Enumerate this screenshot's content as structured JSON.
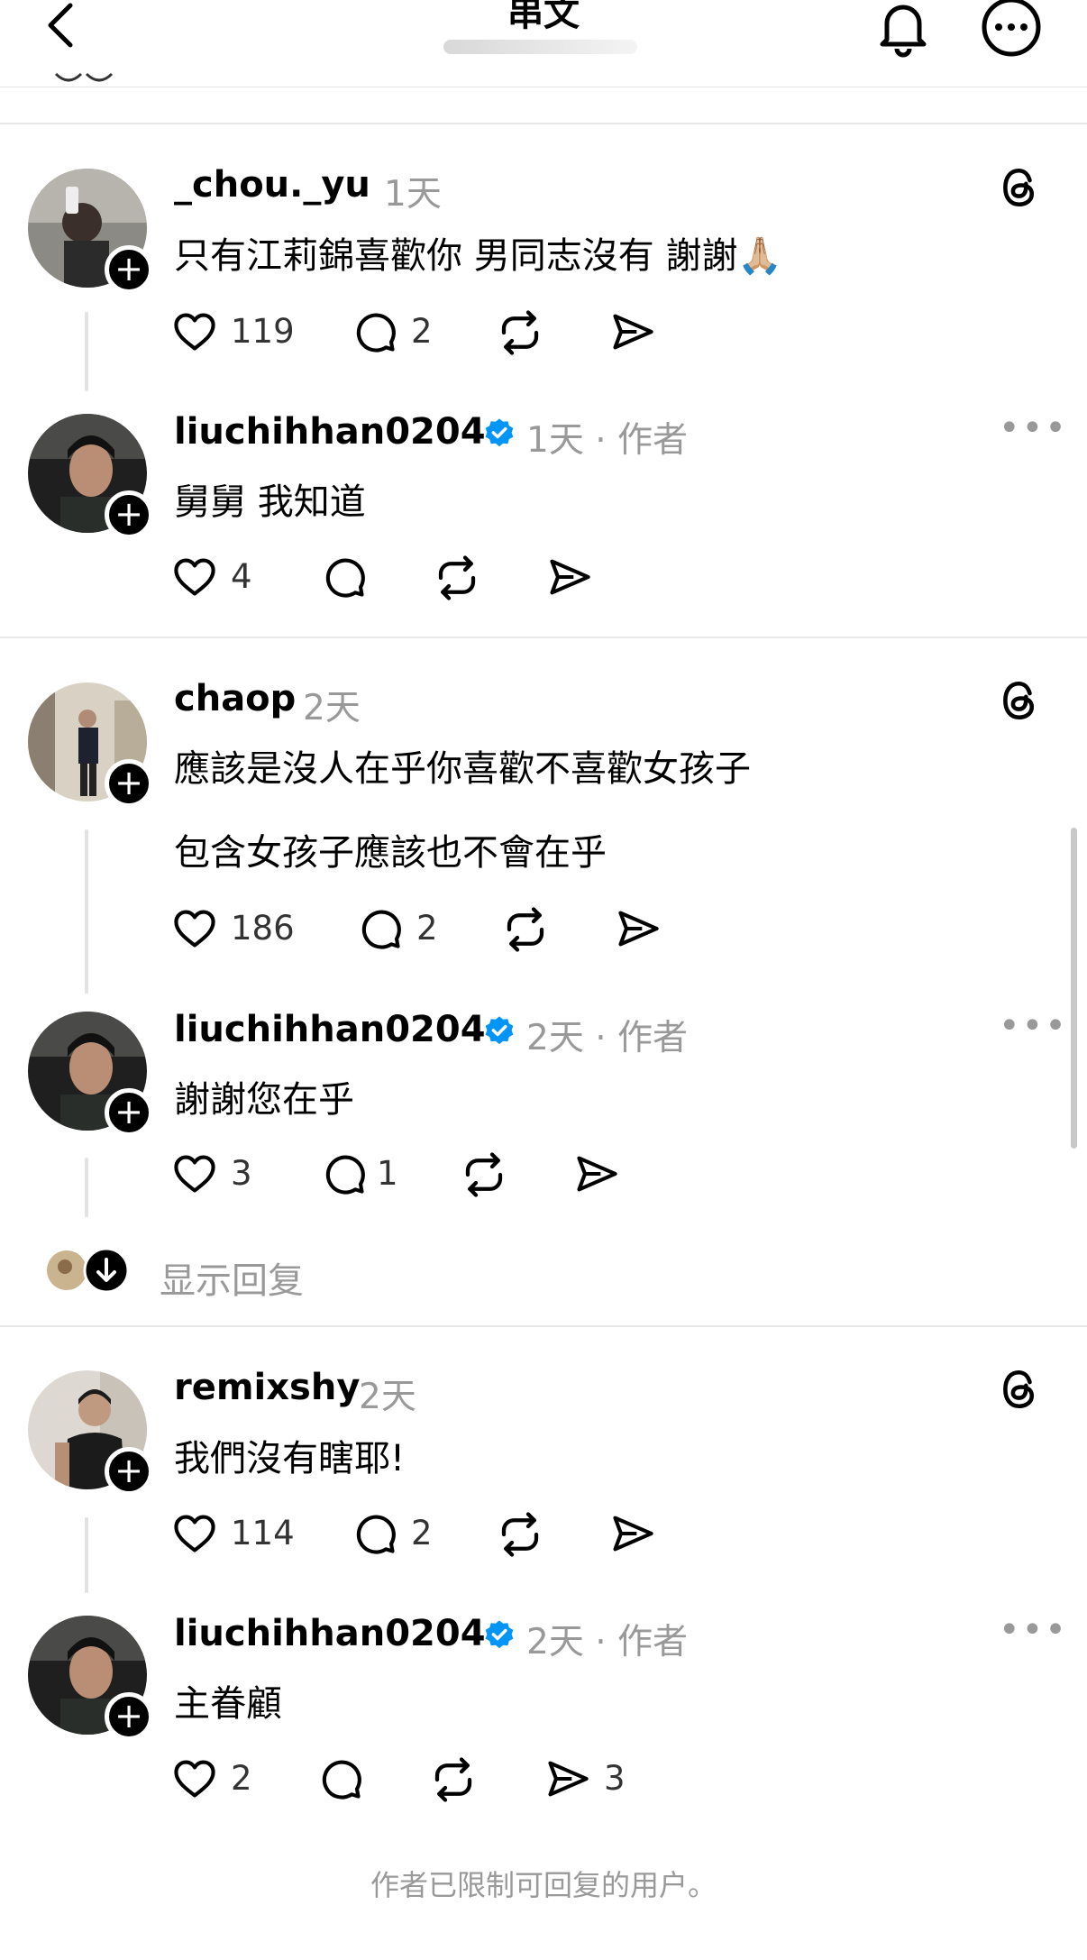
{
  "header": {
    "title": "串文"
  },
  "threads": [
    {
      "comment": {
        "username": "_chou._yu",
        "time": "1天",
        "text": "只有江莉錦喜歡你 男同志沒有 謝謝🙏🏼",
        "likes": "119",
        "replies": "2"
      },
      "reply": {
        "username": "liuchihhan0204",
        "meta": "1天 · 作者",
        "text": "舅舅 我知道",
        "likes": "4"
      }
    },
    {
      "comment": {
        "username": "chaop",
        "time": "2天",
        "text": "應該是沒人在乎你喜歡不喜歡女孩子",
        "text2": "包含女孩子應該也不會在乎",
        "likes": "186",
        "replies": "2"
      },
      "reply": {
        "username": "liuchihhan0204",
        "meta": "2天 · 作者",
        "text": "謝謝您在乎",
        "likes": "3",
        "replies": "1"
      },
      "show_replies": "显示回复"
    },
    {
      "comment": {
        "username": "remixshy",
        "time": "2天",
        "text": "我們沒有瞎耶!",
        "likes": "114",
        "replies": "2"
      },
      "reply": {
        "username": "liuchihhan0204",
        "meta": "2天 · 作者",
        "text": "主眷顧",
        "likes": "2",
        "shares": "3"
      }
    }
  ],
  "footer": "作者已限制可回复的用户。",
  "icons": [
    "back-icon",
    "bell-icon",
    "more-icon",
    "threads-logo-icon",
    "heart-icon",
    "comment-icon",
    "repost-icon",
    "share-icon",
    "verified-icon",
    "follow-plus-icon",
    "down-arrow-icon"
  ],
  "colors": {
    "verified": "#0095F6",
    "muted": "#999999"
  }
}
